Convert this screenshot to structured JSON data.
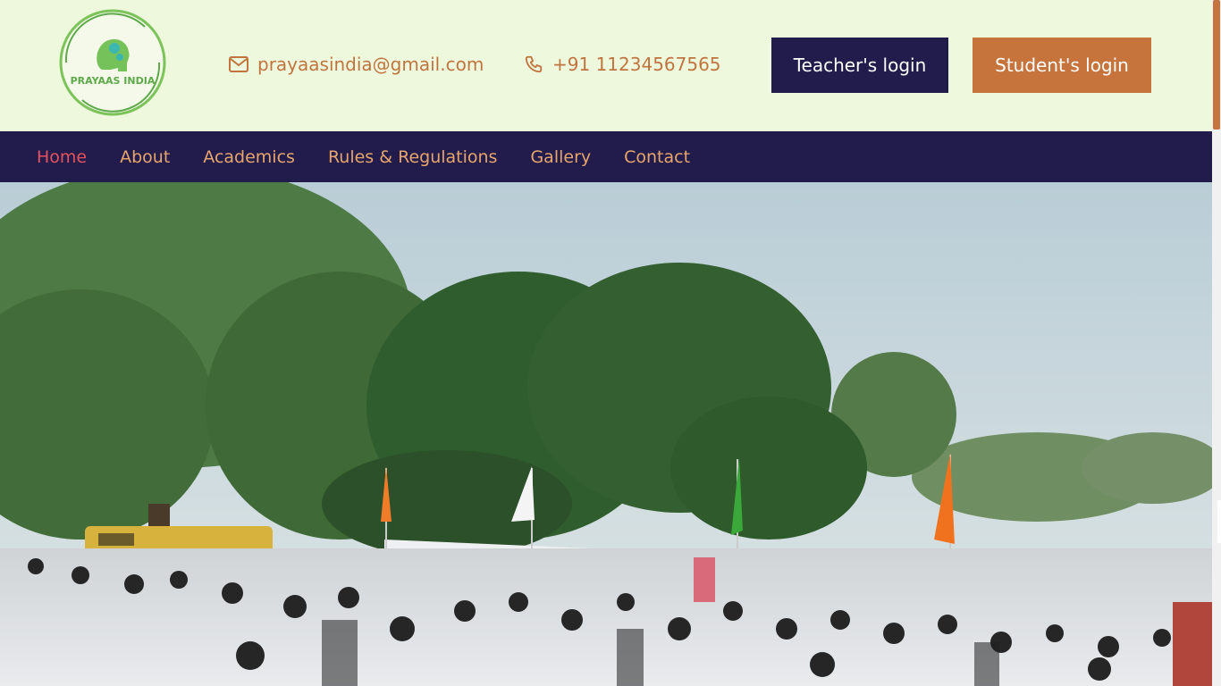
{
  "header": {
    "logo_text": "PRAYAAS INDIA",
    "email": "prayaasindia@gmail.com",
    "phone": "+91 11234567565",
    "teacher_login": "Teacher's login",
    "student_login": "Student's login"
  },
  "nav": {
    "items": [
      "Home",
      "About",
      "Academics",
      "Rules & Regulations",
      "Gallery",
      "Contact"
    ],
    "active": "Home"
  },
  "hero": {
    "image": "school-assembly-photo"
  },
  "colors": {
    "header_bg": "#eef8dc",
    "nav_bg": "#211c4c",
    "accent_orange": "#c6733c",
    "nav_text": "#e7a56b",
    "nav_active": "#e5525d"
  }
}
